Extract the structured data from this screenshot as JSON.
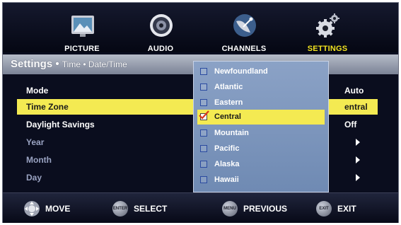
{
  "categories": [
    {
      "label": "PICTURE",
      "icon": "picture-icon",
      "active": false
    },
    {
      "label": "AUDIO",
      "icon": "speaker-icon",
      "active": false
    },
    {
      "label": "CHANNELS",
      "icon": "satellite-dish-icon",
      "active": false
    },
    {
      "label": "SETTINGS",
      "icon": "gears-icon",
      "active": true
    }
  ],
  "header": {
    "title": "Settings •",
    "subtitle": "Time • Date/Time"
  },
  "settings": [
    {
      "name": "Mode",
      "value": "Auto"
    },
    {
      "name": "Time Zone",
      "value": "entral"
    },
    {
      "name": "Daylight Savings",
      "value": "Off"
    },
    {
      "name": "Year",
      "value": ""
    },
    {
      "name": "Month",
      "value": ""
    },
    {
      "name": "Day",
      "value": ""
    }
  ],
  "timezone_options": [
    {
      "label": "Newfoundland",
      "checked": false
    },
    {
      "label": "Atlantic",
      "checked": false
    },
    {
      "label": "Eastern",
      "checked": false
    },
    {
      "label": "Central",
      "checked": true
    },
    {
      "label": "Mountain",
      "checked": false
    },
    {
      "label": "Pacific",
      "checked": false
    },
    {
      "label": "Alaska",
      "checked": false
    },
    {
      "label": "Hawaii",
      "checked": false
    }
  ],
  "hints": [
    {
      "button": "",
      "label": "MOVE",
      "icon": "dpad-icon"
    },
    {
      "button": "ENTER",
      "label": "SELECT",
      "icon": "enter-button-icon"
    },
    {
      "button": "MENU",
      "label": "PREVIOUS",
      "icon": "menu-button-icon"
    },
    {
      "button": "EXIT",
      "label": "EXIT",
      "icon": "exit-button-icon"
    }
  ],
  "colors": {
    "highlight": "#f4ea52",
    "active_category": "#f2e31f",
    "background": "#0a0d1e",
    "dropdown": "#7f97bf"
  }
}
